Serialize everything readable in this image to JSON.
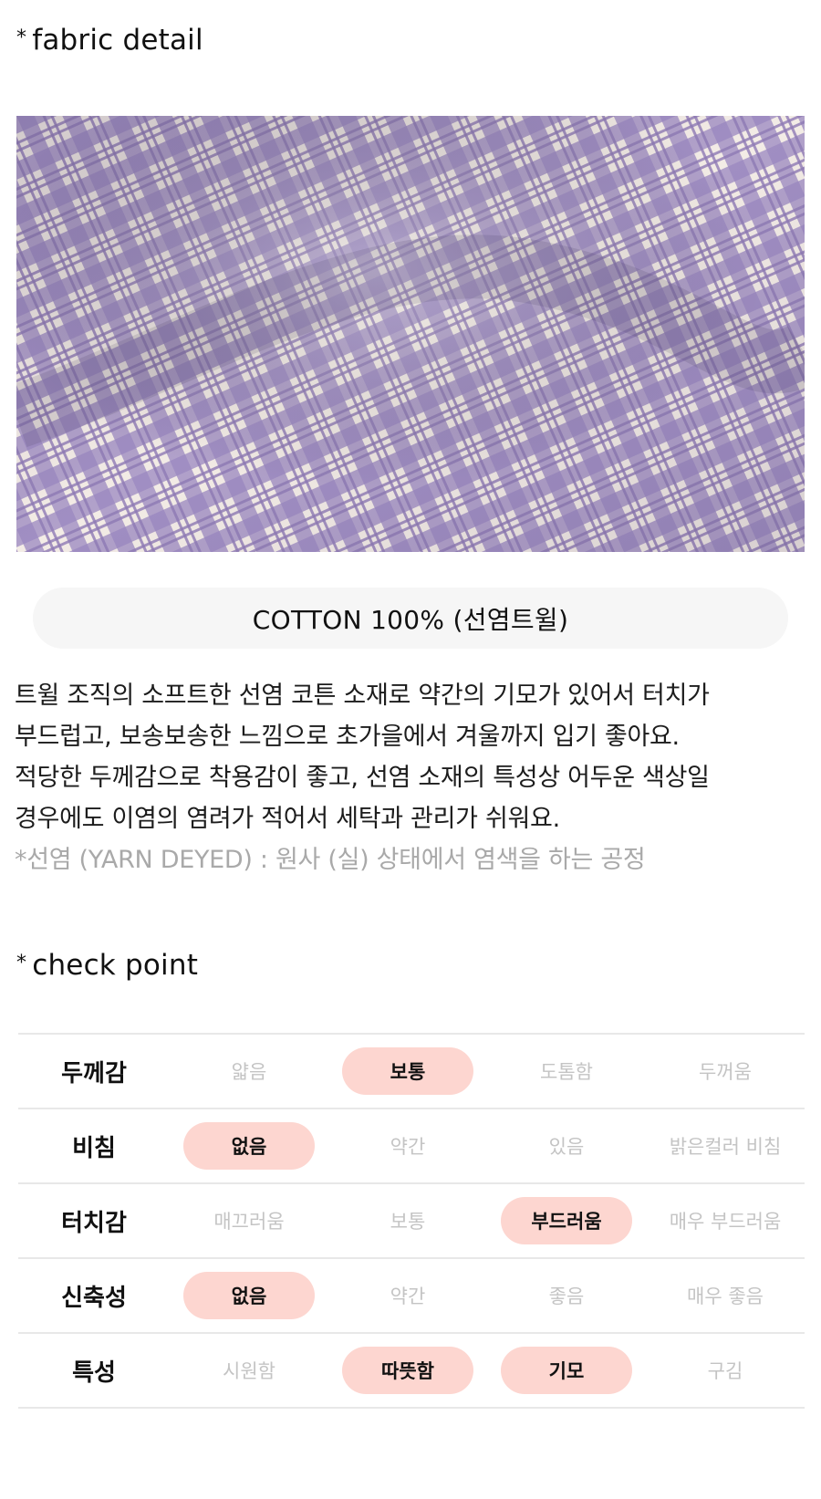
{
  "fabric_section": {
    "star": "*",
    "title": "fabric detail",
    "composition": "COTTON 100% (선염트윌)",
    "description_lines": [
      "트윌 조직의 소프트한 선염 코튼 소재로 약간의 기모가 있어서 터치가",
      "부드럽고, 보송보송한 느낌으로 초가을에서 겨울까지 입기 좋아요.",
      "적당한 두께감으로 착용감이 좋고, 선염 소재의 특성상 어두운 색상일",
      "경우에도 이염의 염려가 적어서 세탁과 관리가 쉬워요."
    ],
    "note": "*선염 (YARN DEYED) : 원사 (실) 상태에서 염색을 하는 공정"
  },
  "check_section": {
    "star": "*",
    "title": "check point",
    "rows": [
      {
        "label": "두께감",
        "options": [
          "얇음",
          "보통",
          "도톰함",
          "두꺼움"
        ],
        "selected": [
          1
        ]
      },
      {
        "label": "비침",
        "options": [
          "없음",
          "약간",
          "있음",
          "밝은컬러 비침"
        ],
        "selected": [
          0
        ]
      },
      {
        "label": "터치감",
        "options": [
          "매끄러움",
          "보통",
          "부드러움",
          "매우 부드러움"
        ],
        "selected": [
          2
        ]
      },
      {
        "label": "신축성",
        "options": [
          "없음",
          "약간",
          "좋음",
          "매우 좋음"
        ],
        "selected": [
          0
        ]
      },
      {
        "label": "특성",
        "options": [
          "시원함",
          "따뜻함",
          "기모",
          "구김"
        ],
        "selected": [
          1,
          2
        ]
      }
    ]
  },
  "colors": {
    "highlight": "#fdd6d0",
    "muted_text": "#c4c4c4",
    "pill_bg": "#f6f6f6",
    "fabric_purple": "#8f7bb5",
    "fabric_cream": "#f3ece6"
  }
}
